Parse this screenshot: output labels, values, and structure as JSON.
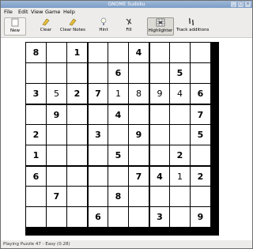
{
  "window": {
    "title": "GNOME Sudoku"
  },
  "menu": [
    "File",
    "Edit",
    "View",
    "Game",
    "Help"
  ],
  "toolbar": {
    "new": "New",
    "clear": "Clear",
    "clear_notes": "Clear Notes",
    "hint": "Hint",
    "fill": "Fill",
    "highlighter": "Highlighter",
    "track": "Track additions"
  },
  "board": [
    [
      {
        "v": "8",
        "g": true
      },
      {
        "v": "",
        "g": false
      },
      {
        "v": "1",
        "g": true
      },
      {
        "v": "",
        "g": false
      },
      {
        "v": "",
        "g": false
      },
      {
        "v": "4",
        "g": true
      },
      {
        "v": "",
        "g": false
      },
      {
        "v": "",
        "g": false
      },
      {
        "v": "",
        "g": false
      }
    ],
    [
      {
        "v": "",
        "g": false
      },
      {
        "v": "",
        "g": false
      },
      {
        "v": "",
        "g": false
      },
      {
        "v": "",
        "g": false
      },
      {
        "v": "6",
        "g": true
      },
      {
        "v": "",
        "g": false
      },
      {
        "v": "",
        "g": false
      },
      {
        "v": "5",
        "g": true
      },
      {
        "v": "",
        "g": false
      }
    ],
    [
      {
        "v": "3",
        "g": true
      },
      {
        "v": "5",
        "g": false
      },
      {
        "v": "2",
        "g": true
      },
      {
        "v": "7",
        "g": true
      },
      {
        "v": "1",
        "g": false
      },
      {
        "v": "8",
        "g": false
      },
      {
        "v": "9",
        "g": false
      },
      {
        "v": "4",
        "g": false
      },
      {
        "v": "6",
        "g": true
      }
    ],
    [
      {
        "v": "",
        "g": false
      },
      {
        "v": "9",
        "g": true
      },
      {
        "v": "",
        "g": false
      },
      {
        "v": "",
        "g": false
      },
      {
        "v": "4",
        "g": true
      },
      {
        "v": "",
        "g": false
      },
      {
        "v": "",
        "g": false
      },
      {
        "v": "",
        "g": false
      },
      {
        "v": "7",
        "g": true
      }
    ],
    [
      {
        "v": "2",
        "g": true
      },
      {
        "v": "",
        "g": false
      },
      {
        "v": "",
        "g": false
      },
      {
        "v": "3",
        "g": true
      },
      {
        "v": "",
        "g": false
      },
      {
        "v": "9",
        "g": true
      },
      {
        "v": "",
        "g": false
      },
      {
        "v": "",
        "g": false
      },
      {
        "v": "5",
        "g": true
      }
    ],
    [
      {
        "v": "1",
        "g": true
      },
      {
        "v": "",
        "g": false
      },
      {
        "v": "",
        "g": false
      },
      {
        "v": "",
        "g": false
      },
      {
        "v": "5",
        "g": true
      },
      {
        "v": "",
        "g": false
      },
      {
        "v": "",
        "g": false
      },
      {
        "v": "2",
        "g": true
      },
      {
        "v": "",
        "g": false
      }
    ],
    [
      {
        "v": "6",
        "g": true
      },
      {
        "v": "",
        "g": false
      },
      {
        "v": "",
        "g": false
      },
      {
        "v": "",
        "g": false
      },
      {
        "v": "",
        "g": false
      },
      {
        "v": "7",
        "g": true
      },
      {
        "v": "4",
        "g": true
      },
      {
        "v": "1",
        "g": false
      },
      {
        "v": "2",
        "g": true
      }
    ],
    [
      {
        "v": "",
        "g": false
      },
      {
        "v": "7",
        "g": true
      },
      {
        "v": "",
        "g": false
      },
      {
        "v": "",
        "g": false
      },
      {
        "v": "8",
        "g": true
      },
      {
        "v": "",
        "g": false
      },
      {
        "v": "",
        "g": false
      },
      {
        "v": "",
        "g": false
      },
      {
        "v": "",
        "g": false
      }
    ],
    [
      {
        "v": "",
        "g": false
      },
      {
        "v": "",
        "g": false
      },
      {
        "v": "",
        "g": false
      },
      {
        "v": "6",
        "g": true
      },
      {
        "v": "",
        "g": false
      },
      {
        "v": "",
        "g": false
      },
      {
        "v": "3",
        "g": true
      },
      {
        "v": "",
        "g": false
      },
      {
        "v": "9",
        "g": true
      }
    ]
  ],
  "status": "Playing Puzzle 47 - Easy (0.28)",
  "colors": {
    "titlebar": "#8aa7cc",
    "window_bg": "#edeceb",
    "grid_line": "#000000"
  },
  "icons": [
    "new-icon",
    "clear-icon",
    "clear-notes-icon",
    "hint-icon",
    "fill-icon",
    "highlighter-icon",
    "track-additions-icon"
  ]
}
